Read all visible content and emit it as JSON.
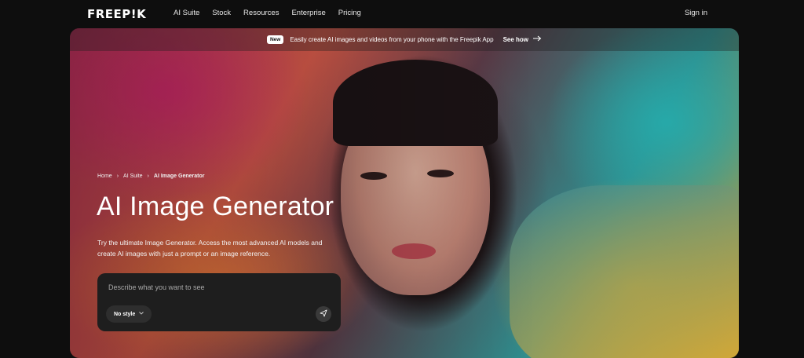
{
  "header": {
    "logo": "FREEP!K",
    "nav": [
      "AI Suite",
      "Stock",
      "Resources",
      "Enterprise",
      "Pricing"
    ],
    "signin": "Sign in"
  },
  "announcement": {
    "badge": "New",
    "text": "Easily create AI images and videos from your phone with the Freepik App",
    "link": "See how",
    "arrow_icon": "arrow-right-icon"
  },
  "breadcrumb": [
    "Home",
    "AI Suite",
    "AI Image Generator"
  ],
  "hero": {
    "title": "AI Image Generator",
    "description": "Try the ultimate Image Generator. Access the most advanced AI models and create AI images with just a prompt or an image reference."
  },
  "prompt": {
    "placeholder": "Describe what you want to see",
    "style_label": "No style",
    "send_icon": "send-icon"
  }
}
